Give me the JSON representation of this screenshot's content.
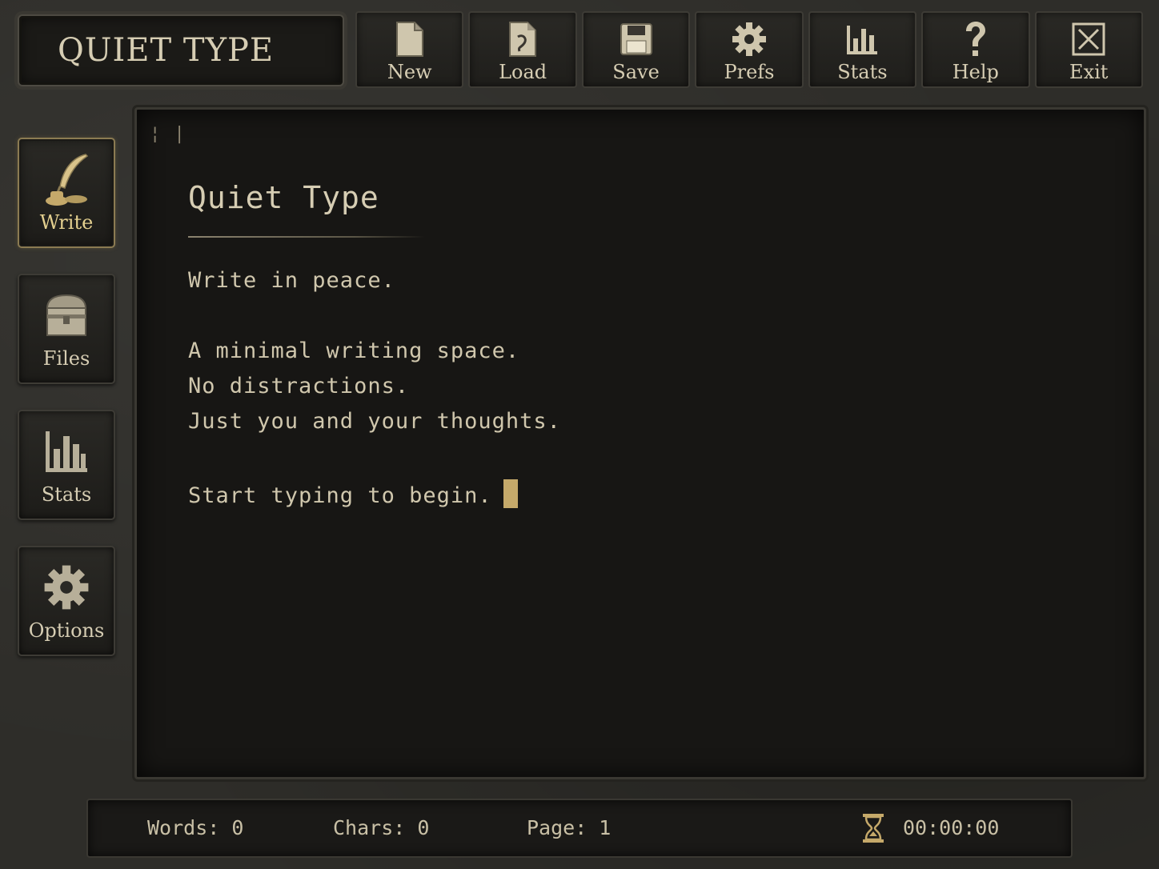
{
  "app": {
    "title": "QUIET TYPE"
  },
  "toolbar": {
    "items": [
      {
        "label": "New",
        "icon": "new-document-icon"
      },
      {
        "label": "Load",
        "icon": "load-document-icon"
      },
      {
        "label": "Save",
        "icon": "floppy-disk-icon"
      },
      {
        "label": "Prefs",
        "icon": "gear-icon"
      },
      {
        "label": "Stats",
        "icon": "bar-chart-icon"
      },
      {
        "label": "Help",
        "icon": "question-mark-icon"
      },
      {
        "label": "Exit",
        "icon": "close-box-icon"
      }
    ]
  },
  "sidebar": {
    "items": [
      {
        "label": "Write",
        "icon": "quill-inkwell-icon",
        "active": true
      },
      {
        "label": "Files",
        "icon": "chest-icon",
        "active": false
      },
      {
        "label": "Stats",
        "icon": "bar-chart-icon",
        "active": false
      },
      {
        "label": "Options",
        "icon": "gear-icon",
        "active": false
      }
    ]
  },
  "editor": {
    "margin_marks": "¦ |",
    "title": "Quiet Type",
    "lines": [
      "Write in peace.",
      "A minimal writing space.",
      "No distractions.",
      "Just you and your thoughts.",
      "Start typing to begin."
    ]
  },
  "status": {
    "words": "Words: 0",
    "chars": "Chars: 0",
    "page": "Page: 1",
    "timer": "00:00:00"
  },
  "colors": {
    "accent": "#c5a96a",
    "text": "#d6cdb3",
    "background": "#171614"
  }
}
